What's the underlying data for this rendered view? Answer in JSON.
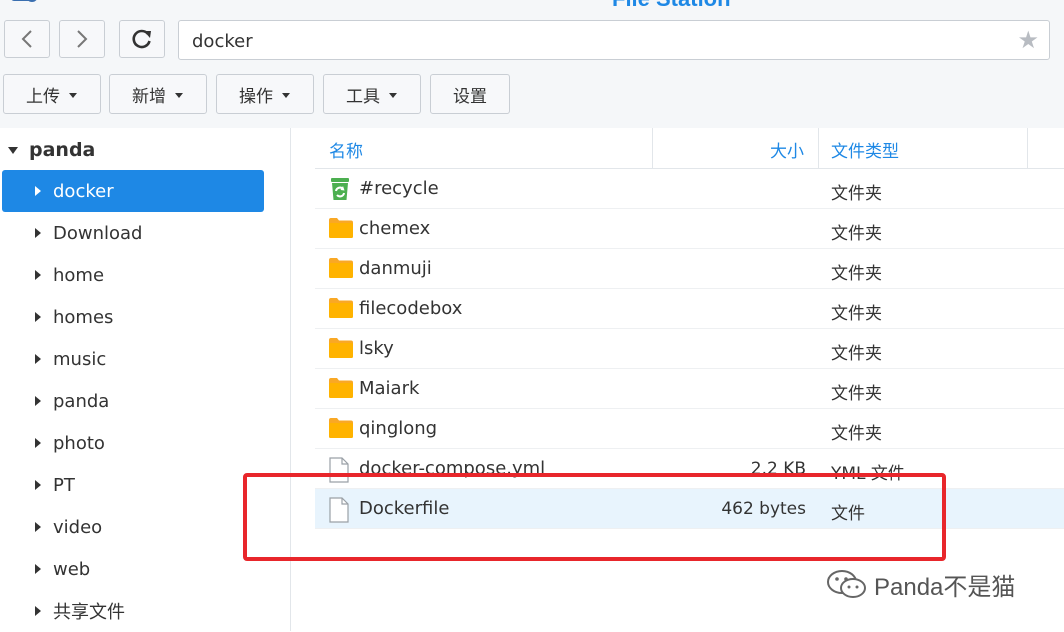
{
  "app": {
    "title": "File Station"
  },
  "nav": {
    "path": "docker"
  },
  "toolbar": [
    {
      "label": "上传",
      "dropdown": true
    },
    {
      "label": "新增",
      "dropdown": true
    },
    {
      "label": "操作",
      "dropdown": true
    },
    {
      "label": "工具",
      "dropdown": true
    },
    {
      "label": "设置",
      "dropdown": false
    }
  ],
  "sidebar": {
    "root": "panda",
    "items": [
      {
        "label": "docker",
        "selected": true
      },
      {
        "label": "Download"
      },
      {
        "label": "home"
      },
      {
        "label": "homes"
      },
      {
        "label": "music"
      },
      {
        "label": "panda"
      },
      {
        "label": "photo"
      },
      {
        "label": "PT"
      },
      {
        "label": "video"
      },
      {
        "label": "web"
      },
      {
        "label": "共享文件"
      }
    ]
  },
  "table": {
    "columns": {
      "name": "名称",
      "size": "大小",
      "type": "文件类型"
    },
    "rows": [
      {
        "name": "#recycle",
        "size": "",
        "type": "文件夹",
        "icon": "recycle-bin-icon"
      },
      {
        "name": "chemex",
        "size": "",
        "type": "文件夹",
        "icon": "folder-icon"
      },
      {
        "name": "danmuji",
        "size": "",
        "type": "文件夹",
        "icon": "folder-icon"
      },
      {
        "name": "filecodebox",
        "size": "",
        "type": "文件夹",
        "icon": "folder-icon"
      },
      {
        "name": "lsky",
        "size": "",
        "type": "文件夹",
        "icon": "folder-icon"
      },
      {
        "name": "Maiark",
        "size": "",
        "type": "文件夹",
        "icon": "folder-icon"
      },
      {
        "name": "qinglong",
        "size": "",
        "type": "文件夹",
        "icon": "folder-icon"
      },
      {
        "name": "docker-compose.yml",
        "size": "2.2 KB",
        "type": "YML 文件",
        "icon": "file-icon"
      },
      {
        "name": "Dockerfile",
        "size": "462 bytes",
        "type": "文件",
        "icon": "file-icon",
        "highlighted": true
      }
    ]
  },
  "watermark": {
    "text": "Panda不是猫"
  },
  "colors": {
    "accent": "#1e88e5",
    "folder": "#f9a825",
    "recycle": "#4caf50",
    "annotation": "#e8262b"
  }
}
